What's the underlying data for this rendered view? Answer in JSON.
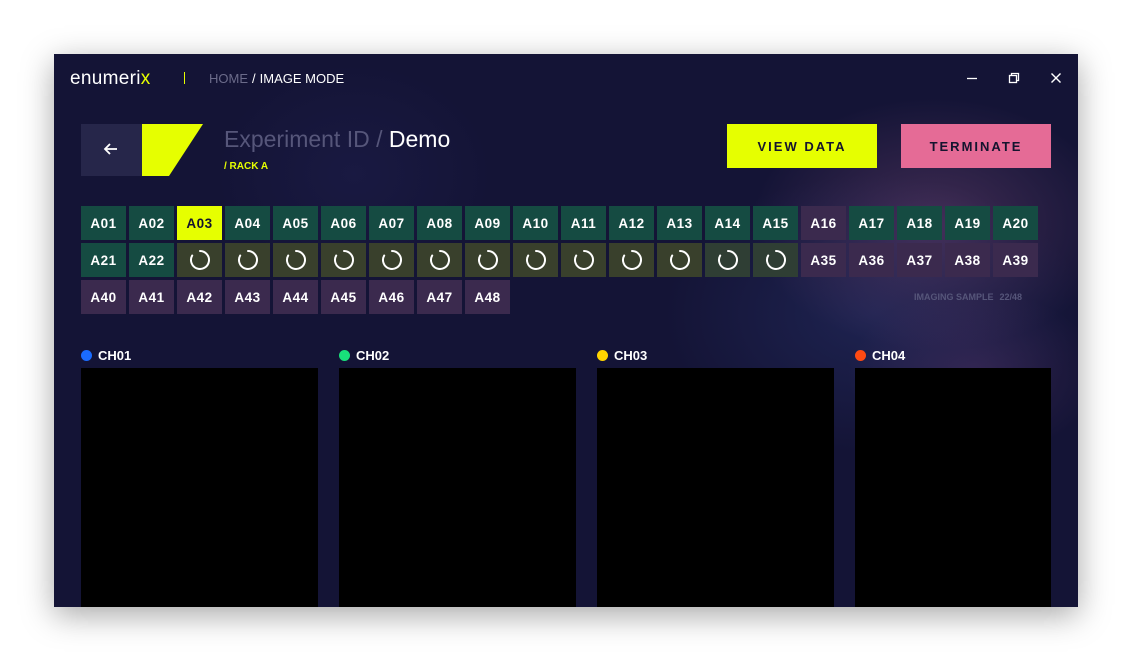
{
  "app": {
    "logo_main": "enumeri",
    "logo_accent": "x",
    "breadcrumb_home": "HOME",
    "breadcrumb_separator": "/",
    "breadcrumb_current": "IMAGE MODE"
  },
  "window_controls": [
    "minimize-icon",
    "restore-icon",
    "close-icon"
  ],
  "header": {
    "back_icon": "arrow-left-icon",
    "experiment_label": "Experiment ID /",
    "experiment_name": "Demo",
    "rack": "/ RACK A",
    "view_data": "VIEW DATA",
    "terminate": "TERMINATE"
  },
  "wells": [
    {
      "label": "A01",
      "state": "done"
    },
    {
      "label": "A02",
      "state": "done"
    },
    {
      "label": "A03",
      "state": "selected"
    },
    {
      "label": "A04",
      "state": "done"
    },
    {
      "label": "A05",
      "state": "done"
    },
    {
      "label": "A06",
      "state": "done"
    },
    {
      "label": "A07",
      "state": "done"
    },
    {
      "label": "A08",
      "state": "done"
    },
    {
      "label": "A09",
      "state": "done"
    },
    {
      "label": "A10",
      "state": "done"
    },
    {
      "label": "A11",
      "state": "done"
    },
    {
      "label": "A12",
      "state": "done"
    },
    {
      "label": "A13",
      "state": "done"
    },
    {
      "label": "A14",
      "state": "done"
    },
    {
      "label": "A15",
      "state": "done"
    },
    {
      "label": "A16",
      "state": "pending"
    },
    {
      "label": "A17",
      "state": "done"
    },
    {
      "label": "A18",
      "state": "done"
    },
    {
      "label": "A19",
      "state": "done"
    },
    {
      "label": "A20",
      "state": "done"
    },
    {
      "label": "A21",
      "state": "done"
    },
    {
      "label": "A22",
      "state": "done"
    },
    {
      "label": "",
      "state": "loading"
    },
    {
      "label": "",
      "state": "loading"
    },
    {
      "label": "",
      "state": "loading"
    },
    {
      "label": "",
      "state": "loading"
    },
    {
      "label": "",
      "state": "loading"
    },
    {
      "label": "",
      "state": "loading"
    },
    {
      "label": "",
      "state": "loading"
    },
    {
      "label": "",
      "state": "loading"
    },
    {
      "label": "",
      "state": "loading"
    },
    {
      "label": "",
      "state": "loading"
    },
    {
      "label": "",
      "state": "loading"
    },
    {
      "label": "",
      "state": "loading"
    },
    {
      "label": "",
      "state": "loading"
    },
    {
      "label": "A35",
      "state": "pending"
    },
    {
      "label": "A36",
      "state": "pending"
    },
    {
      "label": "A37",
      "state": "pending"
    },
    {
      "label": "A38",
      "state": "pending"
    },
    {
      "label": "A39",
      "state": "pending"
    },
    {
      "label": "A40",
      "state": "pending"
    },
    {
      "label": "A41",
      "state": "pending"
    },
    {
      "label": "A42",
      "state": "pending"
    },
    {
      "label": "A43",
      "state": "pending"
    },
    {
      "label": "A44",
      "state": "pending"
    },
    {
      "label": "A45",
      "state": "pending"
    },
    {
      "label": "A46",
      "state": "pending"
    },
    {
      "label": "A47",
      "state": "pending"
    },
    {
      "label": "A48",
      "state": "pending"
    }
  ],
  "status": {
    "label": "IMAGING SAMPLE",
    "count": "22/48"
  },
  "channels": [
    {
      "name": "CH01",
      "color": "#1a6cff"
    },
    {
      "name": "CH02",
      "color": "#18e07a"
    },
    {
      "name": "CH03",
      "color": "#ffd400"
    },
    {
      "name": "CH04",
      "color": "#ff4a12"
    }
  ],
  "colors": {
    "accent": "#e6ff00",
    "terminate": "#e56b96",
    "background": "#141436",
    "well_done": "#154b42",
    "well_pending": "#3b2a4e"
  }
}
